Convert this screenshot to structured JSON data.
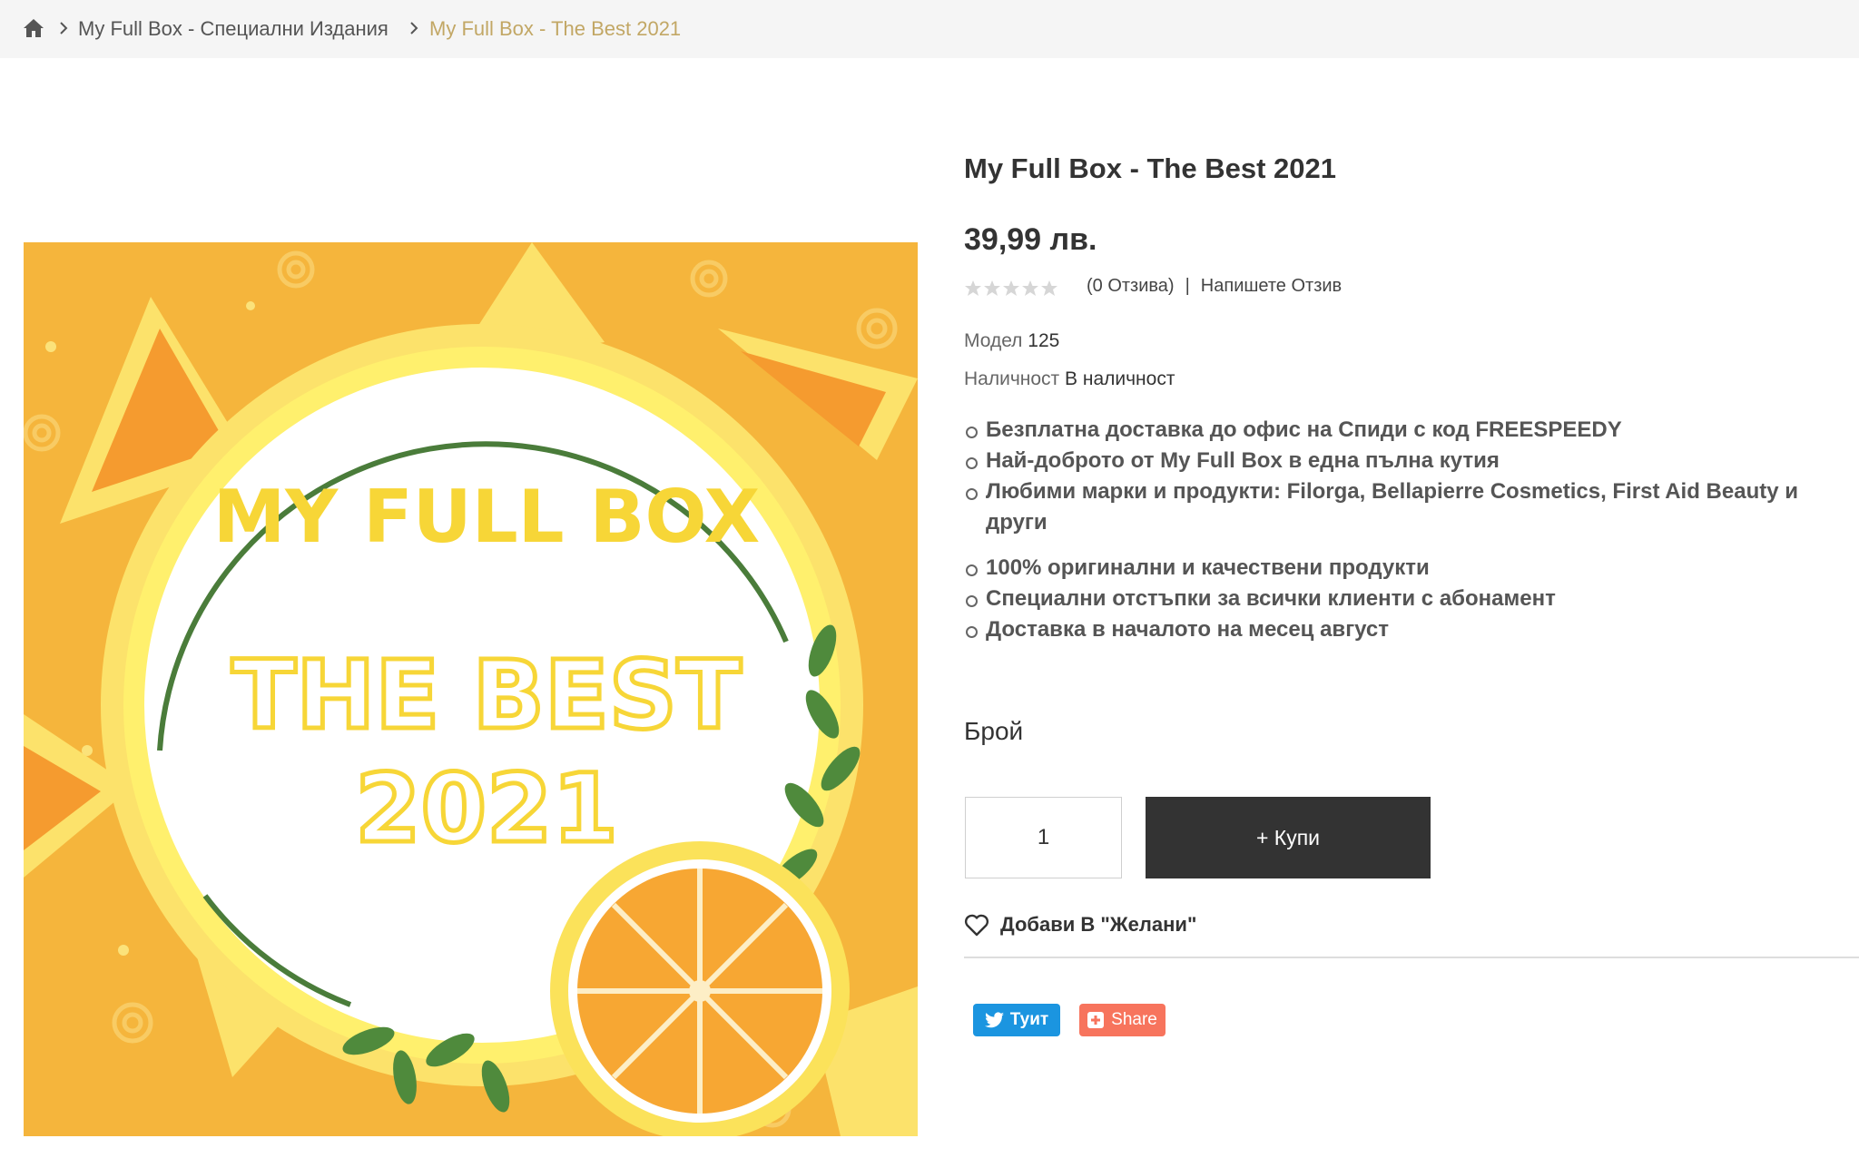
{
  "breadcrumb": {
    "home_icon": "home-icon",
    "items": [
      "My Full Box - Специални Издания",
      "My Full Box - The Best 2021"
    ]
  },
  "colors": {
    "accent": "#c2a765",
    "button_dark": "#333333",
    "tweet": "#1b95e0",
    "share": "#f7745d"
  },
  "product": {
    "title": "My Full Box - The Best 2021",
    "price": "39,99 лв.",
    "rating": 0,
    "reviews_text": "(0 Отзива)",
    "separator": "|",
    "write_review": "Напишете Отзив",
    "model_label": "Модел",
    "model_value": "125",
    "availability_label": "Наличност",
    "availability_value": "В наличност",
    "features_group1": [
      "Безплатна доставка до офис на Спиди с код FREESPEEDY",
      "Най-доброто от My Full Box в една пълна кутия",
      "Любими марки и продукти: Filorga, Bellapierre Cosmetics, First Aid Beauty и други"
    ],
    "features_group2": [
      "100% оригинални и качествени продукти",
      "Специални отстъпки за всички клиенти с абонамент",
      "Доставка в началото на месец август"
    ],
    "image_text": {
      "line1": "MY FULL BOX",
      "line2": "THE BEST",
      "line3": "2021"
    }
  },
  "purchase": {
    "qty_label": "Брой",
    "qty_value": "1",
    "buy_label": "+ Купи",
    "wishlist_label": "Добави В \"Желани\""
  },
  "social": {
    "tweet_label": "Туит",
    "share_label": "Share"
  }
}
